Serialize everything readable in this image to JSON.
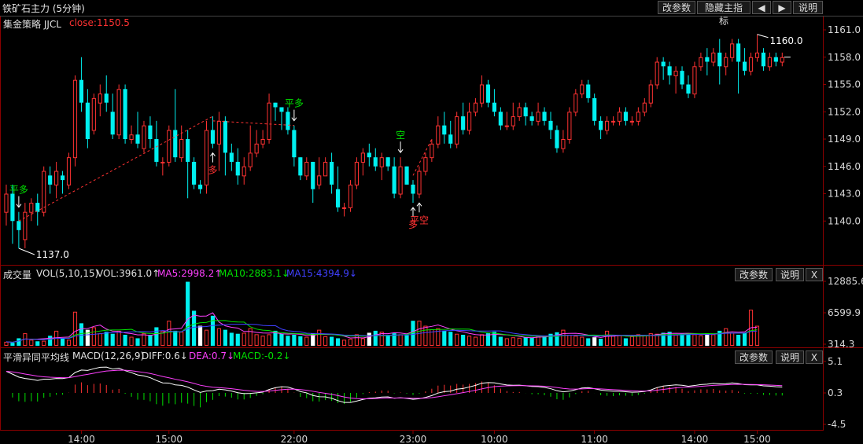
{
  "window": {
    "title": "铁矿石主力 (5分钟)",
    "buttons": [
      "改参数",
      "隐藏主指标",
      "◀",
      "▶",
      "说明"
    ]
  },
  "main_panel": {
    "strategy_name": "集金策略 JJCL",
    "close_label": "close:1150.5",
    "yticks": [
      "1161.0",
      "1158.0",
      "1155.0",
      "1152.0",
      "1149.0",
      "1146.0",
      "1143.0",
      "1140.0"
    ],
    "annotations": {
      "low_price": "1137.0",
      "high_price": "1160.0",
      "signals": [
        "平多",
        "多",
        "平多",
        "空",
        "多",
        "平空"
      ]
    }
  },
  "volume_panel": {
    "name": "成交量",
    "params": "VOL(5,10,15)",
    "vol": "VOL:3961.0↑",
    "ma5": "MA5:2998.2↑",
    "ma10": "MA10:2883.1↓",
    "ma15": "MA15:4394.9↓",
    "yticks": [
      "12885.6",
      "6599.9",
      "314.3"
    ],
    "buttons": [
      "改参数",
      "说明",
      "X"
    ]
  },
  "macd_panel": {
    "name": "平滑异同平均线",
    "params": "MACD(12,26,9)",
    "diff": "DIFF:0.6↓",
    "dea": "DEA:0.7↓",
    "macd": "MACD:-0.2↓",
    "yticks": [
      "5.1",
      "0.3",
      "-4.5"
    ],
    "buttons": [
      "改参数",
      "说明",
      "X"
    ]
  },
  "time_axis": [
    "14:00",
    "15:00",
    "22:00",
    "23:00",
    "10:00",
    "11:00",
    "14:00",
    "15:00"
  ],
  "colors": {
    "up": "#ff3232",
    "down": "#00f0f0",
    "ma5": "#ff40ff",
    "ma10": "#00e000",
    "ma15": "#4040ff",
    "diff": "#ffffff",
    "dea": "#ff40ff",
    "signal_green": "#00e000",
    "signal_red": "#ff3232"
  },
  "chart_data": {
    "type": "candlestick",
    "price_range": [
      1137,
      1161
    ],
    "candles": [
      [
        1141,
        1143,
        1139.5,
        1144
      ],
      [
        1143,
        1140,
        1137.5,
        1144
      ],
      [
        1140,
        1139,
        1137,
        1141
      ],
      [
        1138,
        1141,
        1137,
        1142
      ],
      [
        1141,
        1142,
        1140,
        1142.5
      ],
      [
        1142,
        1141,
        1139.5,
        1143
      ],
      [
        1141,
        1145.5,
        1140.5,
        1146
      ],
      [
        1145,
        1144,
        1143,
        1146
      ],
      [
        1144,
        1145.5,
        1142.5,
        1146.5
      ],
      [
        1145,
        1144.5,
        1143,
        1145.5
      ],
      [
        1144,
        1147,
        1143.5,
        1147.5
      ],
      [
        1147,
        1155.5,
        1146,
        1156
      ],
      [
        1155.5,
        1153,
        1152,
        1158
      ],
      [
        1153,
        1149,
        1148,
        1154.5
      ],
      [
        1150,
        1153.5,
        1149.5,
        1154
      ],
      [
        1153,
        1154,
        1151.5,
        1155
      ],
      [
        1154,
        1153,
        1152,
        1156
      ],
      [
        1152,
        1149.5,
        1149,
        1154
      ],
      [
        1149.5,
        1154.5,
        1149,
        1155
      ],
      [
        1154.5,
        1149,
        1148.5,
        1155
      ],
      [
        1149,
        1149.5,
        1148.5,
        1150.5
      ],
      [
        1149.5,
        1148.5,
        1148,
        1152
      ],
      [
        1148,
        1150.5,
        1147.5,
        1151
      ],
      [
        1150.5,
        1149,
        1148,
        1151.5
      ],
      [
        1149,
        1146.5,
        1146,
        1151
      ],
      [
        1146.5,
        1146.5,
        1145,
        1147
      ],
      [
        1146.5,
        1150,
        1146,
        1150.5
      ],
      [
        1150,
        1147,
        1146.5,
        1154.5
      ],
      [
        1147,
        1149,
        1146.5,
        1150.5
      ],
      [
        1149,
        1146.5,
        1142.5,
        1150
      ],
      [
        1146.5,
        1144,
        1143.5,
        1147
      ],
      [
        1144,
        1143.5,
        1143,
        1144.5
      ],
      [
        1144,
        1150,
        1143,
        1151
      ],
      [
        1150,
        1148.5,
        1148,
        1151.5
      ],
      [
        1148.5,
        1151,
        1145.5,
        1152
      ],
      [
        1151,
        1147.5,
        1145,
        1151.5
      ],
      [
        1147.5,
        1146.5,
        1145.5,
        1148.5
      ],
      [
        1146.5,
        1145,
        1144,
        1148
      ],
      [
        1145,
        1146,
        1144,
        1147
      ],
      [
        1146,
        1147.5,
        1145.5,
        1150.5
      ],
      [
        1147.5,
        1148.5,
        1147,
        1150
      ],
      [
        1148.5,
        1149,
        1148,
        1150
      ],
      [
        1149,
        1153,
        1148.5,
        1154
      ],
      [
        1153,
        1152.5,
        1151,
        1153
      ],
      [
        1152.5,
        1152,
        1150,
        1152.5
      ],
      [
        1152,
        1150,
        1149.5,
        1152.5
      ],
      [
        1150,
        1147,
        1146,
        1150.5
      ],
      [
        1147,
        1145,
        1144.5,
        1147
      ],
      [
        1145,
        1146.5,
        1144.5,
        1147
      ],
      [
        1146.5,
        1143.5,
        1142,
        1146.5
      ],
      [
        1144,
        1145,
        1143.5,
        1147
      ],
      [
        1145,
        1146.5,
        1145,
        1147
      ],
      [
        1146.5,
        1144,
        1143,
        1147.5
      ],
      [
        1143.5,
        1141.5,
        1141,
        1146
      ],
      [
        1141.5,
        1141.5,
        1140.5,
        1142
      ],
      [
        1141.5,
        1144,
        1141,
        1144.5
      ],
      [
        1144,
        1146.5,
        1143.5,
        1147
      ],
      [
        1146.5,
        1147.5,
        1145,
        1148
      ],
      [
        1147.5,
        1147,
        1146,
        1148.5
      ],
      [
        1147,
        1146,
        1145.5,
        1148
      ],
      [
        1146,
        1147,
        1144.5,
        1147.5
      ],
      [
        1147,
        1146,
        1145.5,
        1147
      ],
      [
        1146,
        1143,
        1142.5,
        1147
      ],
      [
        1143,
        1146,
        1142.5,
        1147
      ],
      [
        1146,
        1144,
        1144,
        1146
      ],
      [
        1144,
        1143,
        1142,
        1144.5
      ],
      [
        1143,
        1145.5,
        1142.5,
        1146
      ],
      [
        1145.5,
        1147,
        1145,
        1147.5
      ],
      [
        1147,
        1148.5,
        1146.5,
        1149
      ],
      [
        1148.5,
        1150.5,
        1148,
        1151.5
      ],
      [
        1150.5,
        1149.5,
        1148.5,
        1152
      ],
      [
        1149.5,
        1148.5,
        1148,
        1151
      ],
      [
        1148.5,
        1151.5,
        1148,
        1152
      ],
      [
        1151.5,
        1150,
        1149.5,
        1153
      ],
      [
        1150,
        1152,
        1149.5,
        1153
      ],
      [
        1152,
        1153,
        1151.5,
        1153.5
      ],
      [
        1153,
        1155,
        1152.5,
        1156
      ],
      [
        1155,
        1153,
        1152.5,
        1155.5
      ],
      [
        1153,
        1152,
        1151.5,
        1154.5
      ],
      [
        1152,
        1150.5,
        1150,
        1152.5
      ],
      [
        1150.5,
        1150.5,
        1150,
        1152
      ],
      [
        1150.5,
        1151.5,
        1150,
        1153
      ],
      [
        1151.5,
        1152.5,
        1151,
        1153
      ],
      [
        1152.5,
        1151.5,
        1150.5,
        1153
      ],
      [
        1151.5,
        1151,
        1150.5,
        1152
      ],
      [
        1151,
        1152,
        1150.5,
        1153
      ],
      [
        1152,
        1151,
        1150.5,
        1152.5
      ],
      [
        1151,
        1150,
        1149,
        1152
      ],
      [
        1150,
        1148,
        1147.5,
        1150.5
      ],
      [
        1148,
        1149,
        1147.5,
        1150
      ],
      [
        1149,
        1152,
        1148.5,
        1152.5
      ],
      [
        1152,
        1154,
        1151.5,
        1154.5
      ],
      [
        1154,
        1155,
        1153.5,
        1155.5
      ],
      [
        1155,
        1153.5,
        1153,
        1155.5
      ],
      [
        1153.5,
        1151,
        1150.5,
        1154
      ],
      [
        1151,
        1150,
        1149,
        1151.5
      ],
      [
        1150,
        1151,
        1149.5,
        1151.5
      ],
      [
        1151,
        1151,
        1150.5,
        1151.5
      ],
      [
        1151,
        1152,
        1150.5,
        1152.5
      ],
      [
        1152,
        1151,
        1150.5,
        1152.5
      ],
      [
        1151,
        1151,
        1150.5,
        1151.5
      ],
      [
        1151,
        1152,
        1150.5,
        1152.5
      ],
      [
        1152,
        1153,
        1151.5,
        1153.5
      ],
      [
        1153,
        1155,
        1152.5,
        1155.5
      ],
      [
        1155,
        1157.5,
        1154.5,
        1158
      ],
      [
        1157.5,
        1157,
        1155.5,
        1158
      ],
      [
        1157,
        1156,
        1155,
        1157.5
      ],
      [
        1156,
        1156.5,
        1154,
        1157
      ],
      [
        1156.5,
        1155,
        1154.5,
        1157
      ],
      [
        1155,
        1154,
        1153.5,
        1156
      ],
      [
        1154,
        1157,
        1153.5,
        1157.5
      ],
      [
        1157,
        1158,
        1156.5,
        1158.5
      ],
      [
        1158,
        1157.5,
        1156,
        1159
      ],
      [
        1157.5,
        1158.5,
        1157,
        1159
      ],
      [
        1158.5,
        1157,
        1155,
        1160
      ],
      [
        1157,
        1158,
        1156,
        1158.5
      ],
      [
        1158,
        1159.5,
        1157.5,
        1160
      ],
      [
        1159.5,
        1157.5,
        1154,
        1160
      ],
      [
        1157.5,
        1156.5,
        1156,
        1159
      ],
      [
        1156.5,
        1158,
        1156,
        1158.5
      ],
      [
        1158,
        1158.5,
        1157.5,
        1160.5
      ],
      [
        1158.5,
        1157,
        1156.5,
        1159
      ],
      [
        1157,
        1158,
        1156.5,
        1158.5
      ],
      [
        1158,
        1157.5,
        1157,
        1158.5
      ],
      [
        1157.5,
        1158,
        1157,
        1158.5
      ]
    ],
    "signals": [
      {
        "index": 2,
        "label": "平多",
        "kind": "flat"
      },
      {
        "index": 33,
        "label": "多",
        "kind": "up"
      },
      {
        "index": 46,
        "label": "平多",
        "kind": "flat"
      },
      {
        "index": 63,
        "label": "空",
        "kind": "flat"
      },
      {
        "index": 65,
        "label": "多",
        "kind": "up"
      },
      {
        "index": 66,
        "label": "平空",
        "kind": "up"
      }
    ],
    "volume": [
      800,
      600,
      1500,
      2500,
      1200,
      900,
      1000,
      2000,
      3000,
      1500,
      1200,
      6800,
      4500,
      3200,
      3700,
      2500,
      2800,
      2400,
      3000,
      2200,
      1800,
      1500,
      2500,
      2200,
      3700,
      3000,
      5000,
      3000,
      2800,
      12800,
      7000,
      4000,
      3200,
      6000,
      3500,
      3200,
      2600,
      2400,
      2600,
      3500,
      2300,
      2000,
      2300,
      3000,
      2400,
      2000,
      2200,
      1900,
      1800,
      2500,
      3200,
      1900,
      1800,
      1500,
      1200,
      1400,
      2300,
      1500,
      2600,
      3000,
      2800,
      2200,
      2500,
      2300,
      2100,
      5000,
      5000,
      4000,
      3300,
      3500,
      3000,
      2800,
      2400,
      2200,
      2000,
      1800,
      2300,
      2500,
      2800,
      1800,
      1500,
      1700,
      1600,
      1700,
      1600,
      2000,
      1900,
      2400,
      2700,
      3200,
      2200,
      2000,
      1800,
      1500,
      1700,
      1400,
      3000,
      2000,
      2100,
      1500,
      1900,
      2300,
      2100,
      2500,
      2400,
      2600,
      2800,
      2200,
      2400,
      2500,
      2300,
      2100,
      2500,
      2300,
      3000,
      3500,
      2600,
      2200,
      2600,
      7200,
      4000
    ],
    "volume_range": [
      314.3,
      12885.6
    ],
    "macd_range": [
      -4.5,
      5.1
    ]
  }
}
